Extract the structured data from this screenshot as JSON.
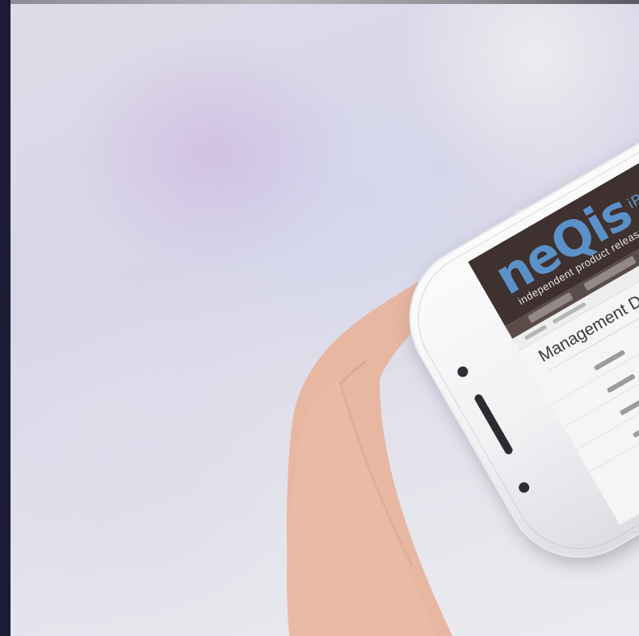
{
  "app": {
    "logo_text": "neQis",
    "logo_suffix": "iPR",
    "tagline": "independent product release",
    "page_title": "Management Dashboard"
  },
  "colors": {
    "app_header": "#3e312f",
    "logo_blue": "#5b91c9",
    "background_lavender": "#d7d6e8",
    "left_strip": "#1b1b33"
  }
}
